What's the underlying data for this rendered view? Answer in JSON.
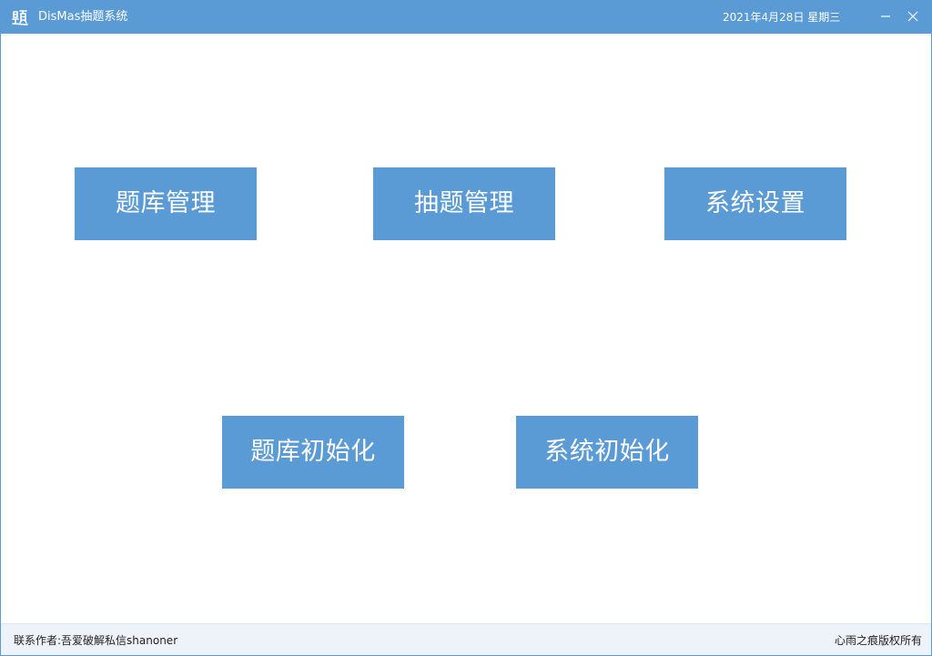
{
  "window": {
    "title": "DisMas抽题系统",
    "datetime": "2021年4月28日  星期三"
  },
  "icons": {
    "app": "question-character-icon",
    "minimize": "minimize-icon",
    "close": "close-icon"
  },
  "colors": {
    "accent": "#5b9bd5",
    "tile_text": "#ffffff",
    "statusbar_bg": "#eef3fa"
  },
  "menu": {
    "question_bank_management": "题库管理",
    "question_draw_management": "抽题管理",
    "system_settings": "系统设置",
    "question_bank_init": "题库初始化",
    "system_init": "系统初始化"
  },
  "statusbar": {
    "contact": "联系作者:吾爱破解私信shanoner",
    "copyright": "心雨之痕版权所有"
  }
}
